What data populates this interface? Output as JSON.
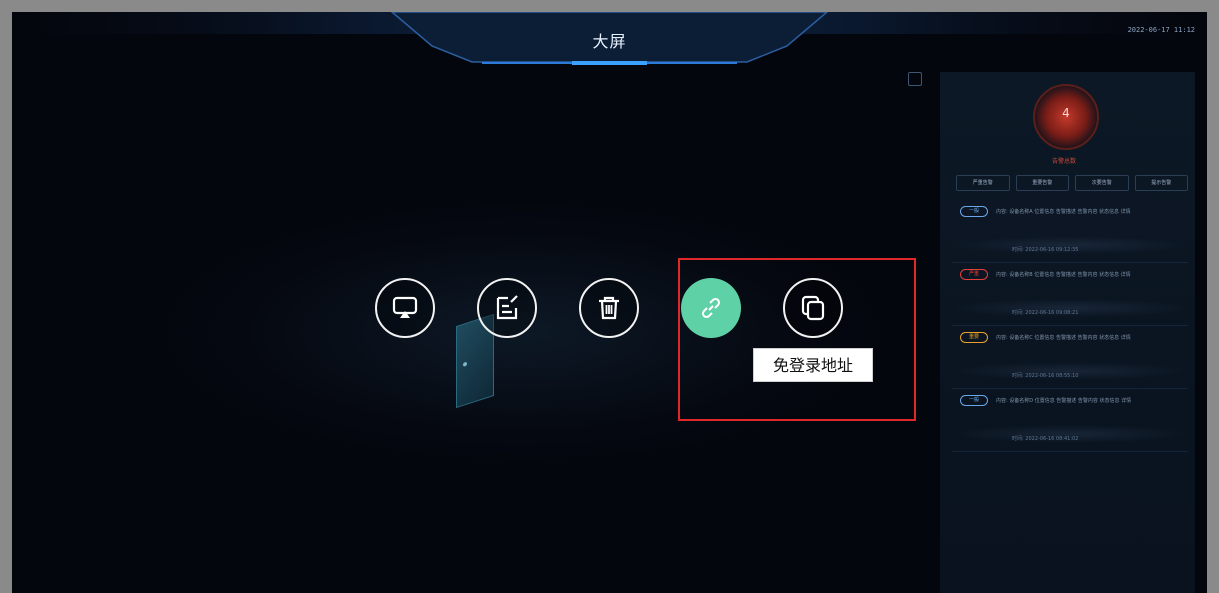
{
  "header": {
    "title": "大屏",
    "datetime": "2022-06-17 11:12"
  },
  "right_panel": {
    "gauge_value": "4",
    "gauge_label": "告警总数",
    "filters": [
      "严重告警",
      "重要告警",
      "次要告警",
      "提示告警"
    ],
    "alarms": [
      {
        "tag": "一般",
        "tag_color": "#6aa7e8",
        "text": "内容: 设备名称A 位置信息 告警描述 告警内容 状态信息 详情",
        "time": "时间: 2022-06-16 09:12:35"
      },
      {
        "tag": "严重",
        "tag_color": "#e0413a",
        "text": "内容: 设备名称B 位置信息 告警描述 告警内容 状态信息 详情",
        "time": "时间: 2022-06-16 09:08:21"
      },
      {
        "tag": "重要",
        "tag_color": "#e8a12a",
        "text": "内容: 设备名称C 位置信息 告警描述 告警内容 状态信息 详情",
        "time": "时间: 2022-06-16 08:55:10"
      },
      {
        "tag": "一般",
        "tag_color": "#6aa7e8",
        "text": "内容: 设备名称D 位置信息 告警描述 告警内容 状态信息 详情",
        "time": "时间: 2022-06-16 08:41:02"
      }
    ]
  },
  "actions": {
    "buttons": [
      {
        "name": "preview",
        "icon": "screen-cast-icon"
      },
      {
        "name": "edit",
        "icon": "edit-icon"
      },
      {
        "name": "delete",
        "icon": "trash-icon"
      },
      {
        "name": "login-free-link",
        "icon": "link-icon",
        "active": true
      },
      {
        "name": "copy",
        "icon": "copy-icon"
      }
    ],
    "tooltip": "免登录地址"
  },
  "colors": {
    "active_button": "#5fd1a6",
    "highlight": "#e02828",
    "background": "#04060d"
  }
}
